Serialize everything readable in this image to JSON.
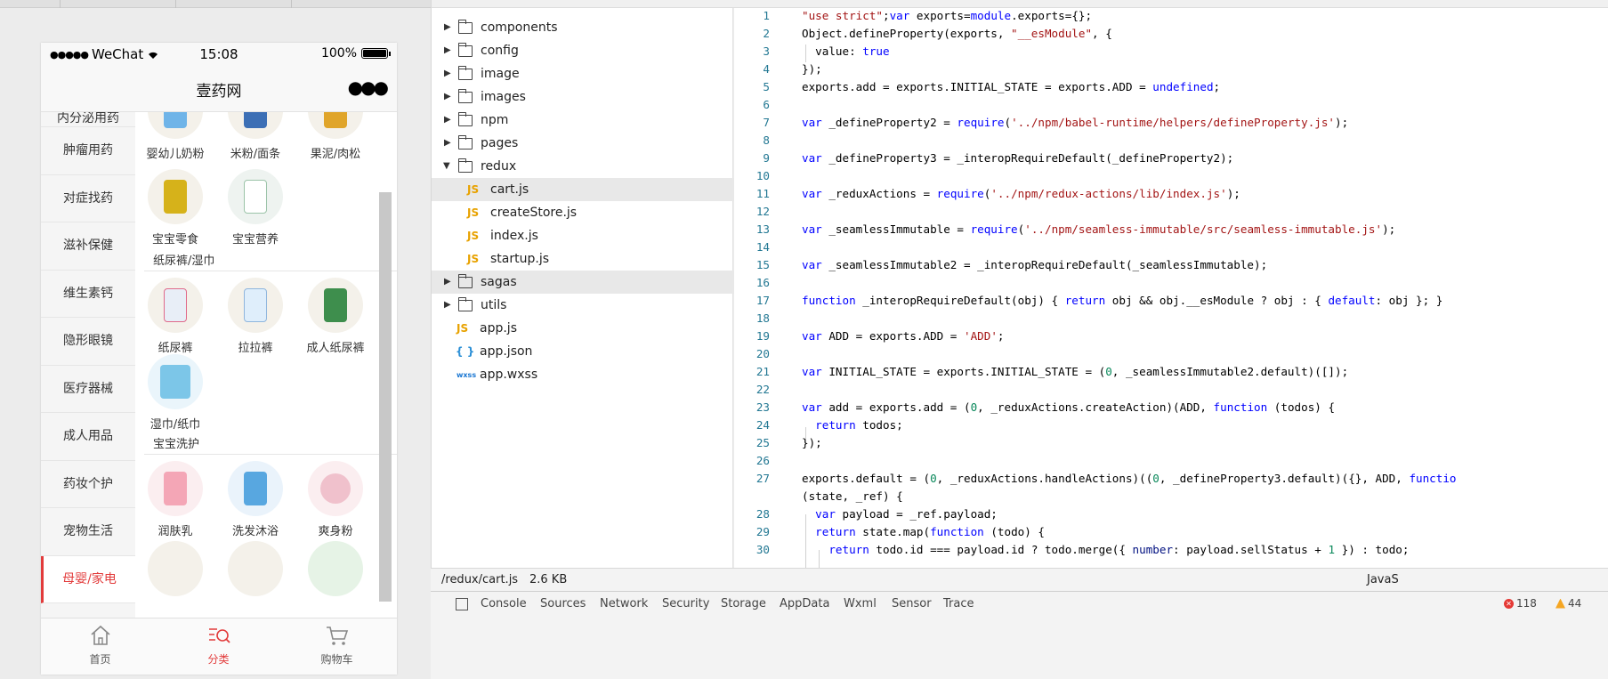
{
  "simulator": {
    "status": {
      "carrier": "WeChat",
      "time": "15:08",
      "battery": "100%"
    },
    "nav_title": "壹药网",
    "categories": [
      {
        "label": "内分泌用药",
        "active": false
      },
      {
        "label": "肿瘤用药",
        "active": false
      },
      {
        "label": "对症找药",
        "active": false
      },
      {
        "label": "滋补保健",
        "active": false
      },
      {
        "label": "维生素钙",
        "active": false
      },
      {
        "label": "隐形眼镜",
        "active": false
      },
      {
        "label": "医疗器械",
        "active": false
      },
      {
        "label": "成人用品",
        "active": false
      },
      {
        "label": "药妆个护",
        "active": false
      },
      {
        "label": "宠物生活",
        "active": false
      },
      {
        "label": "母婴/家电",
        "active": true
      }
    ],
    "sections": {
      "diapers_title": "纸尿裤/湿巾",
      "wash_title": "宝宝洗护"
    },
    "products": {
      "p1": "婴幼儿奶粉",
      "p2": "米粉/面条",
      "p3": "果泥/肉松",
      "p4": "宝宝零食",
      "p5": "宝宝营养",
      "p6": "纸尿裤",
      "p7": "拉拉裤",
      "p8": "成人纸尿裤",
      "p9": "湿巾/纸巾",
      "p10": "润肤乳",
      "p11": "洗发沐浴",
      "p12": "爽身粉"
    },
    "tabs": {
      "home": "首页",
      "category": "分类",
      "cart": "购物车"
    }
  },
  "tree": {
    "components": "components",
    "config": "config",
    "image": "image",
    "images": "images",
    "npm": "npm",
    "pages": "pages",
    "redux": "redux",
    "cart": "cart.js",
    "createStore": "createStore.js",
    "index": "index.js",
    "startup": "startup.js",
    "sagas": "sagas",
    "utils": "utils",
    "appjs": "app.js",
    "appjson": "app.json",
    "appwxss": "app.wxss",
    "js_badge": "JS",
    "json_badge": "{ }",
    "wxss_badge": "wxss"
  },
  "editor": {
    "line_numbers": [
      "1",
      "2",
      "3",
      "4",
      "5",
      "6",
      "7",
      "8",
      "9",
      "10",
      "11",
      "12",
      "13",
      "14",
      "15",
      "16",
      "17",
      "18",
      "19",
      "20",
      "21",
      "22",
      "23",
      "24",
      "25",
      "26",
      "27",
      "",
      "28",
      "29",
      "30"
    ]
  },
  "statusbar": {
    "path": "/redux/cart.js",
    "size": "2.6 KB",
    "lang": "JavaS"
  },
  "devtools": {
    "tabs": [
      "Console",
      "Sources",
      "Network",
      "Security",
      "Storage",
      "AppData",
      "Wxml",
      "Sensor",
      "Trace"
    ],
    "errors": "118",
    "warnings": "44"
  },
  "colors": {
    "accent": "#e23b3b",
    "keyword": "#0000ff",
    "string": "#a31515",
    "number": "#09885a"
  }
}
